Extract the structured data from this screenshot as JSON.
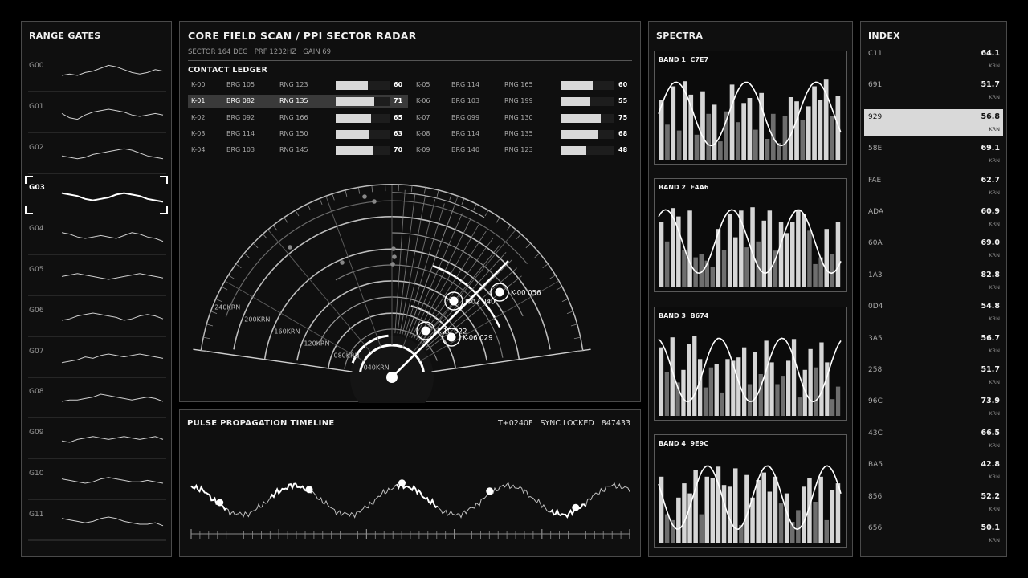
{
  "range_gates": {
    "title": "RANGE GATES",
    "selected_index": 3,
    "gates": [
      {
        "label": "G00",
        "trace": [
          5,
          6,
          5,
          7,
          8,
          10,
          12,
          11,
          9,
          7,
          6,
          7,
          9,
          8
        ]
      },
      {
        "label": "G01",
        "trace": [
          7,
          4,
          3,
          6,
          8,
          9,
          10,
          9,
          8,
          6,
          5,
          6,
          7,
          6
        ]
      },
      {
        "label": "G02",
        "trace": [
          6,
          5,
          4,
          5,
          7,
          8,
          9,
          10,
          11,
          10,
          8,
          6,
          5,
          4
        ]
      },
      {
        "label": "G03",
        "trace": [
          8,
          7,
          6,
          4,
          3,
          4,
          5,
          7,
          8,
          7,
          6,
          4,
          3,
          2
        ]
      },
      {
        "label": "G04",
        "trace": [
          9,
          8,
          6,
          5,
          6,
          7,
          6,
          5,
          7,
          9,
          8,
          6,
          5,
          3
        ]
      },
      {
        "label": "G05",
        "trace": [
          7,
          8,
          9,
          8,
          7,
          6,
          5,
          6,
          7,
          8,
          9,
          8,
          7,
          6
        ]
      },
      {
        "label": "G06",
        "trace": [
          5,
          6,
          8,
          9,
          10,
          9,
          8,
          7,
          5,
          6,
          8,
          9,
          8,
          6
        ]
      },
      {
        "label": "G07",
        "trace": [
          4,
          5,
          6,
          8,
          7,
          9,
          10,
          9,
          8,
          9,
          10,
          9,
          8,
          7
        ]
      },
      {
        "label": "G08",
        "trace": [
          5,
          6,
          6,
          7,
          8,
          10,
          9,
          8,
          7,
          6,
          7,
          8,
          7,
          5
        ]
      },
      {
        "label": "G09",
        "trace": [
          6,
          5,
          7,
          8,
          9,
          8,
          7,
          8,
          9,
          8,
          7,
          8,
          9,
          7
        ]
      },
      {
        "label": "G10",
        "trace": [
          8,
          7,
          6,
          5,
          6,
          8,
          9,
          8,
          7,
          6,
          6,
          7,
          6,
          5
        ]
      },
      {
        "label": "G11",
        "trace": [
          9,
          8,
          7,
          6,
          7,
          9,
          10,
          9,
          7,
          6,
          5,
          5,
          6,
          4
        ]
      }
    ]
  },
  "radar": {
    "title": "CORE FIELD SCAN / PPI SECTOR RADAR",
    "meta": "SECTOR 164 DEG   PRF 1232HZ   GAIN 69",
    "ledger_title": "CONTACT LEDGER",
    "selected_row": "K-01",
    "contacts_left": [
      {
        "id": "K-00",
        "brg": "BRG 105",
        "rng": "RNG 123",
        "val": 60
      },
      {
        "id": "K-01",
        "brg": "BRG 082",
        "rng": "RNG 135",
        "val": 71
      },
      {
        "id": "K-02",
        "brg": "BRG 092",
        "rng": "RNG 166",
        "val": 65
      },
      {
        "id": "K-03",
        "brg": "BRG 114",
        "rng": "RNG 150",
        "val": 63
      },
      {
        "id": "K-04",
        "brg": "BRG 103",
        "rng": "RNG 145",
        "val": 70
      }
    ],
    "contacts_right": [
      {
        "id": "K-05",
        "brg": "BRG 114",
        "rng": "RNG 165",
        "val": 60
      },
      {
        "id": "K-06",
        "brg": "BRG 103",
        "rng": "RNG 199",
        "val": 55
      },
      {
        "id": "K-07",
        "brg": "BRG 099",
        "rng": "RNG 130",
        "val": 75
      },
      {
        "id": "K-08",
        "brg": "BRG 114",
        "rng": "RNG 135",
        "val": 68
      },
      {
        "id": "K-09",
        "brg": "BRG 140",
        "rng": "RNG 123",
        "val": 48
      }
    ],
    "range_labels": [
      "040KRN",
      "080KRN",
      "120KRN",
      "160KRN",
      "200KRN",
      "240KRN"
    ],
    "tracks": [
      {
        "label": "K-00 056"
      },
      {
        "label": "K-02 040"
      },
      {
        "label": "K-10 022"
      },
      {
        "label": "K-06 029"
      }
    ]
  },
  "timeline": {
    "title": "PULSE PROPAGATION TIMELINE",
    "status": "T+0240F   SYNC LOCKED   847433"
  },
  "spectra": {
    "title": "SPECTRA",
    "bands": [
      {
        "label": "BAND 1  C7E7",
        "bars": [
          72,
          42,
          88,
          35,
          94,
          78,
          30,
          82,
          55,
          66,
          22,
          58,
          90,
          45,
          68,
          74,
          36,
          80,
          25,
          55,
          20,
          52,
          75,
          70,
          48,
          64,
          88,
          72,
          96,
          52,
          76
        ],
        "shade": [
          1,
          0,
          1,
          0,
          1,
          1,
          0,
          1,
          0,
          1,
          0,
          0,
          1,
          0,
          1,
          1,
          0,
          1,
          0,
          0,
          0,
          0,
          1,
          1,
          0,
          1,
          1,
          1,
          1,
          0,
          1
        ]
      },
      {
        "label": "BAND 2  F4A6",
        "bars": [
          78,
          55,
          95,
          85,
          45,
          92,
          36,
          40,
          32,
          24,
          70,
          45,
          88,
          60,
          92,
          48,
          96,
          55,
          80,
          92,
          44,
          78,
          65,
          78,
          92,
          88,
          68,
          28,
          36,
          70,
          40,
          78
        ],
        "shade": [
          1,
          0,
          1,
          1,
          0,
          1,
          0,
          0,
          0,
          0,
          1,
          0,
          1,
          1,
          1,
          0,
          1,
          0,
          1,
          1,
          0,
          1,
          1,
          1,
          1,
          1,
          0,
          0,
          0,
          1,
          0,
          1
        ]
      },
      {
        "label": "BAND 3  B674",
        "bars": [
          82,
          52,
          94,
          40,
          55,
          86,
          96,
          68,
          34,
          58,
          62,
          28,
          68,
          66,
          70,
          82,
          38,
          76,
          50,
          90,
          64,
          38,
          48,
          66,
          92,
          22,
          55,
          80,
          58,
          88,
          64,
          20,
          35
        ],
        "shade": [
          1,
          0,
          1,
          0,
          1,
          1,
          1,
          1,
          0,
          0,
          1,
          0,
          1,
          1,
          1,
          1,
          0,
          1,
          0,
          1,
          1,
          0,
          0,
          1,
          1,
          0,
          1,
          1,
          0,
          1,
          1,
          0,
          0
        ]
      },
      {
        "label": "BAND 4  9E9C",
        "bars": [
          80,
          35,
          28,
          55,
          72,
          60,
          88,
          35,
          80,
          78,
          92,
          70,
          68,
          90,
          22,
          82,
          55,
          76,
          85,
          62,
          80,
          48,
          60,
          26,
          40,
          68,
          78,
          50,
          80,
          28,
          64,
          72
        ],
        "shade": [
          1,
          0,
          0,
          1,
          1,
          1,
          1,
          0,
          1,
          1,
          1,
          1,
          1,
          1,
          0,
          1,
          1,
          1,
          1,
          1,
          1,
          0,
          1,
          0,
          0,
          1,
          1,
          0,
          1,
          0,
          1,
          1
        ]
      }
    ]
  },
  "index": {
    "title": "INDEX",
    "unit": "KRN",
    "selected": "929",
    "items": [
      {
        "id": "C11",
        "value": "64.1"
      },
      {
        "id": "691",
        "value": "51.7"
      },
      {
        "id": "929",
        "value": "56.8"
      },
      {
        "id": "58E",
        "value": "69.1"
      },
      {
        "id": "FAE",
        "value": "62.7"
      },
      {
        "id": "ADA",
        "value": "60.9"
      },
      {
        "id": "60A",
        "value": "69.0"
      },
      {
        "id": "1A3",
        "value": "82.8"
      },
      {
        "id": "0D4",
        "value": "54.8"
      },
      {
        "id": "3A5",
        "value": "56.7"
      },
      {
        "id": "258",
        "value": "51.7"
      },
      {
        "id": "96C",
        "value": "73.9"
      },
      {
        "id": "43C",
        "value": "66.5"
      },
      {
        "id": "BA5",
        "value": "42.8"
      },
      {
        "id": "856",
        "value": "52.2"
      },
      {
        "id": "656",
        "value": "50.1"
      }
    ]
  },
  "colors": {
    "bg": "#000000",
    "panel": "#0f0f0f",
    "border": "#4a4a4a",
    "highlight": "#d9d9d9",
    "text": "#e8e8e8",
    "dim": "#9a9a9a"
  }
}
